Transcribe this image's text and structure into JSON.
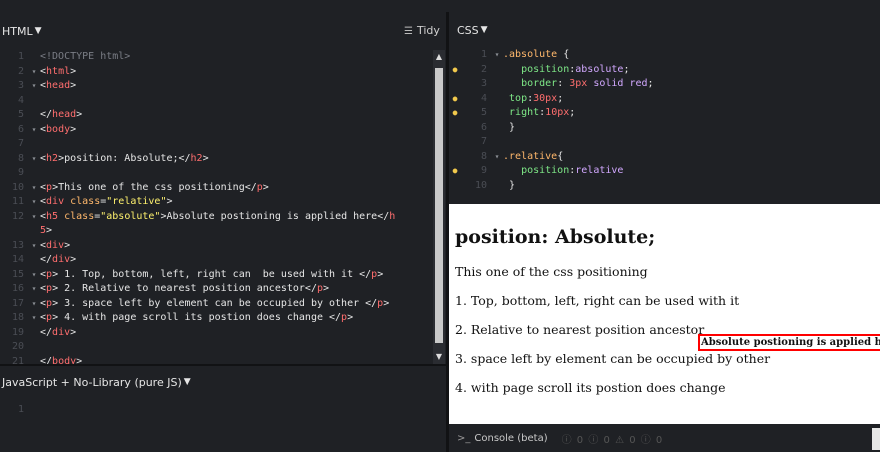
{
  "html_panel": {
    "title": "HTML",
    "tidy_label": "Tidy",
    "lines": [
      {
        "n": "1",
        "fold": "",
        "html": "<span class='doctype'>&lt;!DOCTYPE html&gt;</span>"
      },
      {
        "n": "2",
        "fold": "▾",
        "html": "<span class='txt'>&lt;</span><span class='tag'>html</span><span class='txt'>&gt;</span>"
      },
      {
        "n": "3",
        "fold": "▾",
        "html": "<span class='txt'>&lt;</span><span class='tag'>head</span><span class='txt'>&gt;</span>"
      },
      {
        "n": "4",
        "fold": "",
        "html": ""
      },
      {
        "n": "5",
        "fold": "",
        "html": "<span class='txt'>&lt;/</span><span class='tag'>head</span><span class='txt'>&gt;</span>"
      },
      {
        "n": "6",
        "fold": "▾",
        "html": "<span class='txt'>&lt;</span><span class='tag'>body</span><span class='txt'>&gt;</span>"
      },
      {
        "n": "7",
        "fold": "",
        "html": ""
      },
      {
        "n": "8",
        "fold": "▾",
        "html": "<span class='txt'>&lt;</span><span class='tag'>h2</span><span class='txt'>&gt;position: Absolute;&lt;/</span><span class='tag'>h2</span><span class='txt'>&gt;</span>"
      },
      {
        "n": "9",
        "fold": "",
        "html": ""
      },
      {
        "n": "10",
        "fold": "▾",
        "html": "<span class='txt'>&lt;</span><span class='tag'>p</span><span class='txt'>&gt;This one of the css positioning&lt;/</span><span class='tag'>p</span><span class='txt'>&gt;</span>"
      },
      {
        "n": "11",
        "fold": "▾",
        "html": "<span class='txt'>&lt;</span><span class='tag'>div</span> <span class='attr'>class</span><span class='txt'>=</span><span class='str'>\"relative\"</span><span class='txt'>&gt;</span>"
      },
      {
        "n": "12",
        "fold": "▾",
        "html": "<span class='txt'>&lt;</span><span class='tag'>h5</span> <span class='attr'>class</span><span class='txt'>=</span><span class='str'>\"absolute\"</span><span class='txt'>&gt;Absolute postioning is applied here&lt;/</span><span class='tag'>h</span>"
      },
      {
        "n": "",
        "fold": "",
        "html": "<span class='tag'>5</span><span class='txt'>&gt;</span>"
      },
      {
        "n": "13",
        "fold": "▾",
        "html": "<span class='txt'>&lt;</span><span class='tag'>div</span><span class='txt'>&gt;</span>"
      },
      {
        "n": "14",
        "fold": "",
        "html": "<span class='txt'>&lt;/</span><span class='tag'>div</span><span class='txt'>&gt;</span>"
      },
      {
        "n": "15",
        "fold": "▾",
        "html": "<span class='txt'>&lt;</span><span class='tag'>p</span><span class='txt'>&gt; 1. Top, bottom, left, right can  be used with it &lt;/</span><span class='tag'>p</span><span class='txt'>&gt;</span>"
      },
      {
        "n": "16",
        "fold": "▾",
        "html": "<span class='txt'>&lt;</span><span class='tag'>p</span><span class='txt'>&gt; 2. Relative to nearest position ancestor&lt;/</span><span class='tag'>p</span><span class='txt'>&gt;</span>"
      },
      {
        "n": "17",
        "fold": "▾",
        "html": "<span class='txt'>&lt;</span><span class='tag'>p</span><span class='txt'>&gt; 3. space left by element can be occupied by other &lt;/</span><span class='tag'>p</span><span class='txt'>&gt;</span>"
      },
      {
        "n": "18",
        "fold": "▾",
        "html": "<span class='txt'>&lt;</span><span class='tag'>p</span><span class='txt'>&gt; 4. with page scroll its postion does change &lt;/</span><span class='tag'>p</span><span class='txt'>&gt;</span>"
      },
      {
        "n": "19",
        "fold": "",
        "html": "<span class='txt'>&lt;/</span><span class='tag'>div</span><span class='txt'>&gt;</span>"
      },
      {
        "n": "20",
        "fold": "",
        "html": ""
      },
      {
        "n": "21",
        "fold": "",
        "html": "<span class='txt'>&lt;/</span><span class='tag'>body</span><span class='txt'>&gt;</span>"
      },
      {
        "n": "22",
        "fold": "",
        "html": "<span class='txt'>&lt;/</span><span class='tag'>html</span><span class='txt'>&gt;</span>"
      }
    ]
  },
  "js_panel": {
    "title": "JavaScript + No-Library (pure JS)",
    "first_line_number": "1"
  },
  "css_panel": {
    "title": "CSS",
    "lines": [
      {
        "n": "1",
        "fold": "▾",
        "gut": "",
        "html": "<span class='sel'>.absolute</span> <span class='punct'>{</span>"
      },
      {
        "n": "2",
        "fold": "",
        "gut": "●",
        "html": "   <span class='prop'>position</span><span class='punct'>:</span><span class='val'>absolute</span><span class='punct'>;</span>"
      },
      {
        "n": "3",
        "fold": "",
        "gut": "",
        "html": "   <span class='prop'>border</span><span class='punct'>: </span><span class='num'>3px</span> <span class='val'>solid red</span><span class='punct'>;</span>"
      },
      {
        "n": "4",
        "fold": "",
        "gut": "●",
        "html": " <span class='prop'>top</span><span class='punct'>:</span><span class='num'>30px</span><span class='punct'>;</span>"
      },
      {
        "n": "5",
        "fold": "",
        "gut": "●",
        "html": " <span class='prop'>right</span><span class='punct'>:</span><span class='num'>10px</span><span class='punct'>;</span>"
      },
      {
        "n": "6",
        "fold": "",
        "gut": "",
        "html": " <span class='punct'>}</span>"
      },
      {
        "n": "7",
        "fold": "",
        "gut": "",
        "html": ""
      },
      {
        "n": "8",
        "fold": "▾",
        "gut": "",
        "html": "<span class='sel'>.relative</span><span class='punct'>{</span>"
      },
      {
        "n": "9",
        "fold": "",
        "gut": "●",
        "html": "   <span class='prop'>position</span><span class='punct'>:</span><span class='val'>relative</span>"
      },
      {
        "n": "10",
        "fold": "",
        "gut": "",
        "html": " <span class='punct'>}</span>"
      }
    ]
  },
  "preview": {
    "heading": "position: Absolute;",
    "intro": "This one of the css positioning",
    "absolute_label": "Absolute postioning is applied here",
    "items": [
      "1. Top, bottom, left, right can be used with it",
      "2. Relative to nearest position ancestor",
      "3. space left by element can be occupied by other",
      "4. with page scroll its postion does change"
    ]
  },
  "console": {
    "label": "Console (beta)",
    "prompt": ">_",
    "counts": "ⓘ 0  ⓘ 0  ⚠ 0  ⓘ 0"
  }
}
